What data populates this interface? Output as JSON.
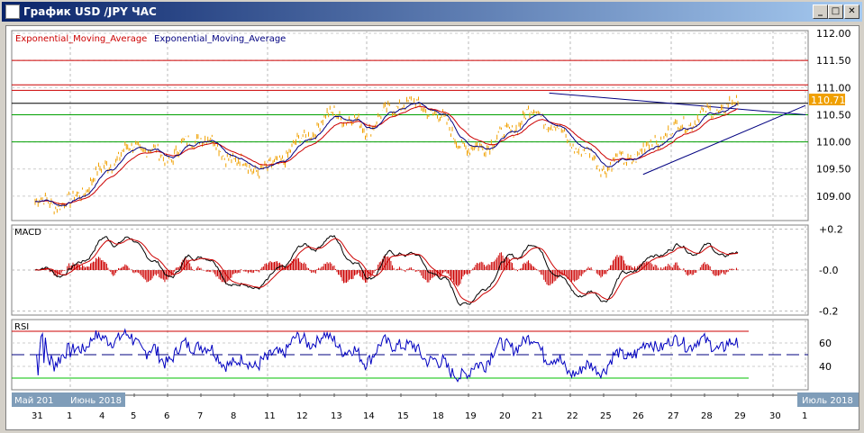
{
  "window": {
    "title": "График USD /JPY  ЧАС",
    "minimize": "_",
    "maximize": "□",
    "close": "✕"
  },
  "legend": {
    "ema_red": "Exponential_Moving_Average",
    "ema_blue": "Exponential_Moving_Average"
  },
  "panels": {
    "macd_label": "MACD",
    "rsi_label": "RSI"
  },
  "colors": {
    "price": "#f0a000",
    "ema_fast": "#000080",
    "ema_slow": "#cc0000",
    "macd_hist": "#cc0000",
    "rsi": "#0000c0",
    "last_price_bg": "#f0a000"
  },
  "chart_data": {
    "type": "line",
    "title": "USD/JPY H1",
    "price_axis": {
      "ticks": [
        "112.00",
        "111.50",
        "111.00",
        "110.50",
        "110.00",
        "109.50",
        "109.00"
      ],
      "ylim": [
        108.55,
        112.05
      ]
    },
    "last_price": "110.71",
    "dates": [
      "31",
      "1",
      "4",
      "5",
      "6",
      "7",
      "8",
      "11",
      "12",
      "13",
      "14",
      "15",
      "18",
      "19",
      "20",
      "21",
      "22",
      "25",
      "26",
      "27",
      "28",
      "29",
      "30",
      "1"
    ],
    "month_labels": [
      "Май 201",
      "Июнь 2018",
      "Июль 2018"
    ],
    "daily_close": [
      108.9,
      108.85,
      109.5,
      109.95,
      109.7,
      110.15,
      109.65,
      109.45,
      110.0,
      110.55,
      110.25,
      110.75,
      110.55,
      109.8,
      110.1,
      110.6,
      110.0,
      109.55,
      109.75,
      110.2,
      110.5,
      110.71
    ],
    "horizontal_levels": [
      {
        "value": 111.5,
        "color": "#cc0000"
      },
      {
        "value": 111.05,
        "color": "#cc0000"
      },
      {
        "value": 110.95,
        "color": "#cc0000"
      },
      {
        "value": 110.71,
        "color": "#000000"
      },
      {
        "value": 110.5,
        "color": "#00a000"
      },
      {
        "value": 110.0,
        "color": "#00a000"
      }
    ],
    "trendlines": [
      {
        "from": [
          15.4,
          110.9
        ],
        "to": [
          23,
          110.5
        ]
      },
      {
        "from": [
          18.2,
          109.4
        ],
        "to": [
          23.1,
          110.67
        ]
      }
    ],
    "macd_axis": {
      "ticks": [
        "+0.2",
        "-0.0",
        "-0.2"
      ],
      "ylim": [
        -0.22,
        0.22
      ]
    },
    "rsi_axis": {
      "ticks": [
        "60",
        "40"
      ],
      "ylim": [
        20,
        80
      ],
      "levels": [
        70,
        30,
        50
      ]
    }
  }
}
